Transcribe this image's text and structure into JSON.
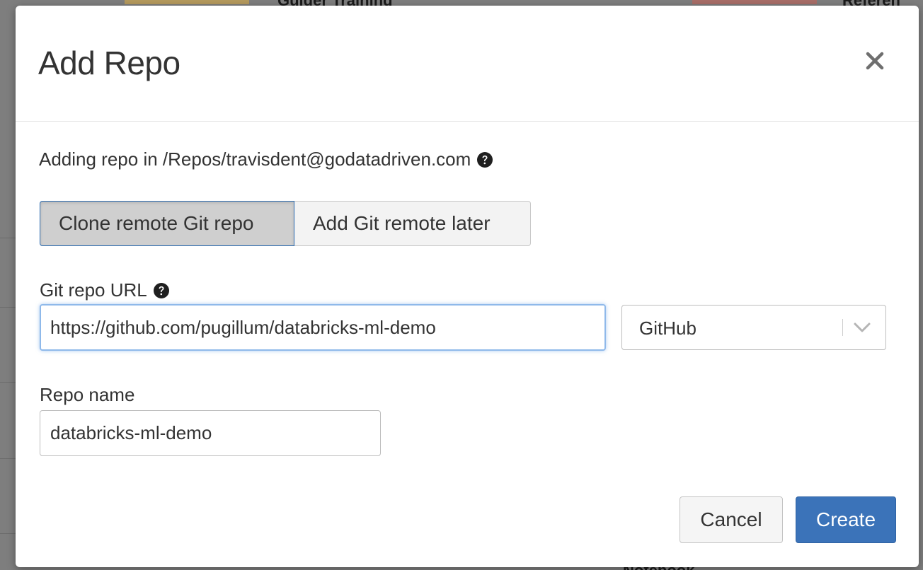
{
  "background": {
    "top_left_text": "Guider Training",
    "top_right_text": "Referen",
    "bottom_text": "Notebook"
  },
  "modal": {
    "title": "Add Repo",
    "close_icon": "close-icon",
    "path_text": "Adding repo in /Repos/travisdent@godatadriven.com",
    "help_icon": "question-circle-icon",
    "mode_options": [
      {
        "label": "Clone remote Git repo",
        "selected": true
      },
      {
        "label": "Add Git remote later",
        "selected": false
      }
    ],
    "git_url": {
      "label": "Git repo URL",
      "value": "https://github.com/pugillum/databricks-ml-demo"
    },
    "provider": {
      "selected": "GitHub",
      "chevron_icon": "chevron-down-icon"
    },
    "repo_name": {
      "label": "Repo name",
      "value": "databricks-ml-demo"
    },
    "buttons": {
      "cancel": "Cancel",
      "create": "Create"
    },
    "colors": {
      "primary": "#3b73b9",
      "focus_border": "#8fb9ea",
      "active_segment_bg": "#cfcfcf"
    }
  }
}
